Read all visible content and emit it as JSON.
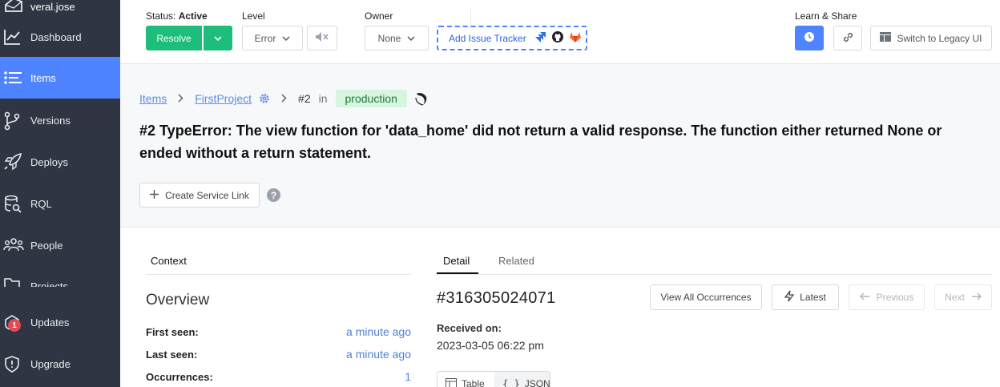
{
  "sidebar": {
    "user": "veral.jose",
    "items": [
      {
        "label": "Dashboard",
        "icon": "chart-icon"
      },
      {
        "label": "Items",
        "icon": "list-icon"
      },
      {
        "label": "Versions",
        "icon": "branch-icon"
      },
      {
        "label": "Deploys",
        "icon": "rocket-icon"
      },
      {
        "label": "RQL",
        "icon": "database-search-icon"
      },
      {
        "label": "People",
        "icon": "people-icon"
      },
      {
        "label": "Projects",
        "icon": "folder-icon"
      },
      {
        "label": "Updates",
        "icon": "gift-icon",
        "badge": "1"
      },
      {
        "label": "Upgrade",
        "icon": "shield-icon"
      }
    ]
  },
  "topbar": {
    "status_prefix": "Status:",
    "status_value": "Active",
    "resolve_label": "Resolve",
    "level_label": "Level",
    "level_value": "Error",
    "owner_label": "Owner",
    "owner_value": "None",
    "issue_tracker_label": "Add Issue Tracker",
    "learn_share_label": "Learn & Share",
    "legacy_label": "Switch to Legacy UI"
  },
  "header": {
    "crumb_items": "Items",
    "crumb_project": "FirstProject",
    "item_number": "#2",
    "in_text": "in",
    "environment": "production",
    "title": "#2 TypeError: The view function for 'data_home' did not return a valid response. The function either returned None or ended without a return statement.",
    "create_service_link": "Create Service Link"
  },
  "context": {
    "tab_label": "Context",
    "overview_title": "Overview",
    "fields": [
      {
        "label": "First seen:",
        "value": "a minute ago"
      },
      {
        "label": "Last seen:",
        "value": "a minute ago"
      },
      {
        "label": "Occurrences:",
        "value": "1"
      }
    ]
  },
  "detail": {
    "tabs": [
      "Detail",
      "Related"
    ],
    "occurrence_id": "#316305024071",
    "view_all": "View All Occurrences",
    "latest": "Latest",
    "previous": "Previous",
    "next": "Next",
    "received_label": "Received on:",
    "received_value": "2023-03-05 06:22 pm",
    "view_table": "Table",
    "view_json": "JSON"
  },
  "colors": {
    "sidebar_bg": "#2f3543",
    "accent": "#4e84ff",
    "resolve": "#1dbd7b"
  }
}
